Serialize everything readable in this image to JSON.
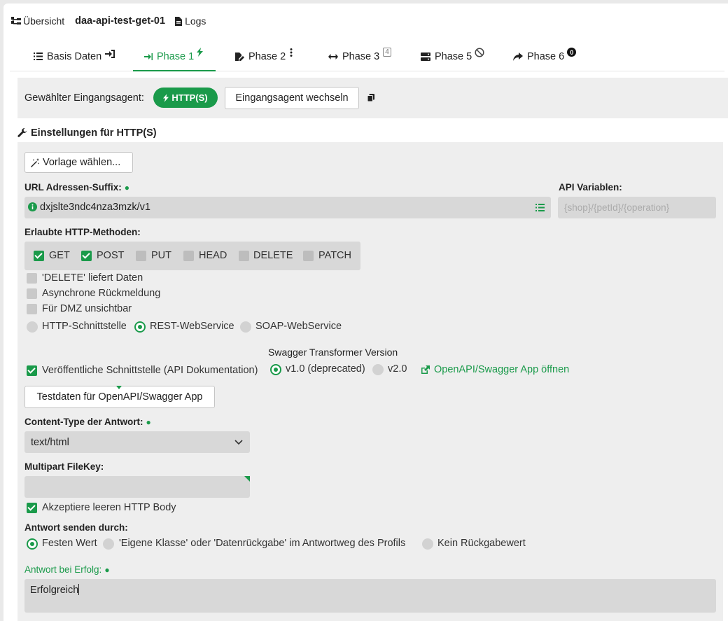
{
  "topbar": {
    "overview": "Übersicht",
    "project": "daa-api-test-get-01",
    "logs": "Logs"
  },
  "tabs": [
    {
      "label": "Basis Daten",
      "active": false
    },
    {
      "label": "Phase 1",
      "active": true
    },
    {
      "label": "Phase 2",
      "active": false
    },
    {
      "label": "Phase 3",
      "active": false,
      "badge": "4"
    },
    {
      "label": "Phase 5",
      "active": false
    },
    {
      "label": "Phase 6",
      "active": false,
      "badge": "0"
    }
  ],
  "agent": {
    "label": "Gewählter Eingangsagent:",
    "selected": "HTTP(S)",
    "change_button": "Eingangsagent wechseln"
  },
  "settings": {
    "title": "Einstellungen für HTTP(S)",
    "template_button": "Vorlage wählen...",
    "url_suffix_label": "URL Adressen-Suffix:",
    "url_suffix_value": "dxjslte3ndc4nza3mzk/v1",
    "api_vars_label": "API Variablen:",
    "api_vars_placeholder": "{shop}/{petId}/{operation}",
    "methods_label": "Erlaubte HTTP-Methoden:",
    "methods": [
      {
        "label": "GET",
        "checked": true
      },
      {
        "label": "POST",
        "checked": true
      },
      {
        "label": "PUT",
        "checked": false
      },
      {
        "label": "HEAD",
        "checked": false
      },
      {
        "label": "DELETE",
        "checked": false
      },
      {
        "label": "PATCH",
        "checked": false
      }
    ],
    "options": [
      {
        "label": "'DELETE' liefert Daten",
        "checked": false
      },
      {
        "label": "Asynchrone Rückmeldung",
        "checked": false
      },
      {
        "label": "Für DMZ unsichtbar",
        "checked": false
      }
    ],
    "interface_types": [
      {
        "label": "HTTP-Schnittstelle",
        "selected": false
      },
      {
        "label": "REST-WebService",
        "selected": true
      },
      {
        "label": "SOAP-WebService",
        "selected": false
      }
    ],
    "swagger_version_label": "Swagger Transformer Version",
    "public_interface_label": "Veröffentliche Schnittstelle (API Dokumentation)",
    "public_interface_checked": true,
    "swagger_versions": [
      {
        "label": "v1.0 (deprecated)",
        "selected": true
      },
      {
        "label": "v2.0",
        "selected": false
      }
    ],
    "swagger_link": "OpenAPI/Swagger App öffnen",
    "testdata_button": "Testdaten für OpenAPI/Swagger App",
    "content_type_label": "Content-Type der Antwort:",
    "content_type_value": "text/html",
    "multipart_label": "Multipart FileKey:",
    "multipart_value": "",
    "accept_empty_label": "Akzeptiere leeren HTTP Body",
    "accept_empty_checked": true,
    "send_by_label": "Antwort senden durch:",
    "send_by_options": [
      {
        "label": "Festen Wert",
        "selected": true
      },
      {
        "label": "'Eigene Klasse' oder 'Datenrückgabe' im Antwortweg des Profils",
        "selected": false
      },
      {
        "label": "Kein Rückgabewert",
        "selected": false
      }
    ],
    "success_label": "Antwort bei Erfolg:",
    "success_value": "Erfolgreich"
  },
  "colors": {
    "accent": "#1a9a4a",
    "field_bg": "#d8d8d8",
    "panel_bg": "#eeeeee"
  }
}
